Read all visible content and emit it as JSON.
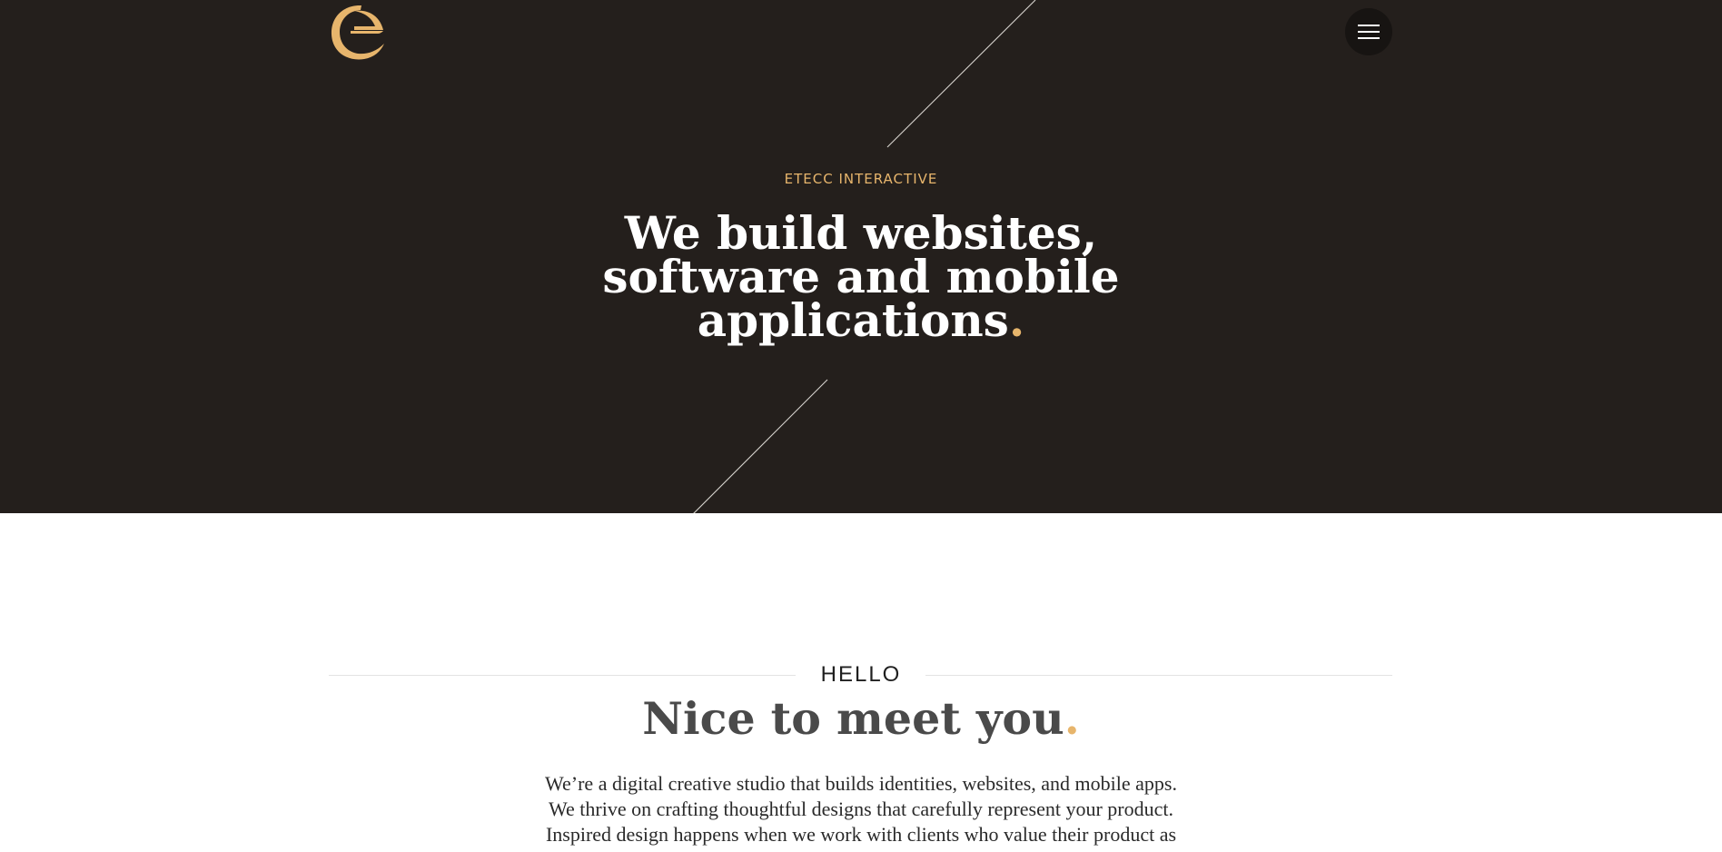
{
  "header": {
    "logo_name": "etecc-logo",
    "menu_icon": "hamburger-menu-icon"
  },
  "hero": {
    "eyebrow": "ETECC INTERACTIVE",
    "headline_line_1": "We build websites,",
    "headline_line_2": "software and mobile",
    "headline_line_3": "applications",
    "headline_dot": "."
  },
  "about": {
    "label": "HELLO",
    "title": "Nice to meet you",
    "title_dot": ".",
    "body_line_1": "We’re a digital creative studio that builds identities, websites, and mobile apps.",
    "body_line_2": "We thrive on crafting thoughtful designs that carefully represent your product.",
    "body_line_3": "Inspired design happens when we work with clients who value their product as"
  },
  "colors": {
    "hero_background": "#241f1c",
    "accent": "#e7b56c",
    "heading_gray": "#4a4a4a",
    "body_text": "#2a2a2a"
  }
}
